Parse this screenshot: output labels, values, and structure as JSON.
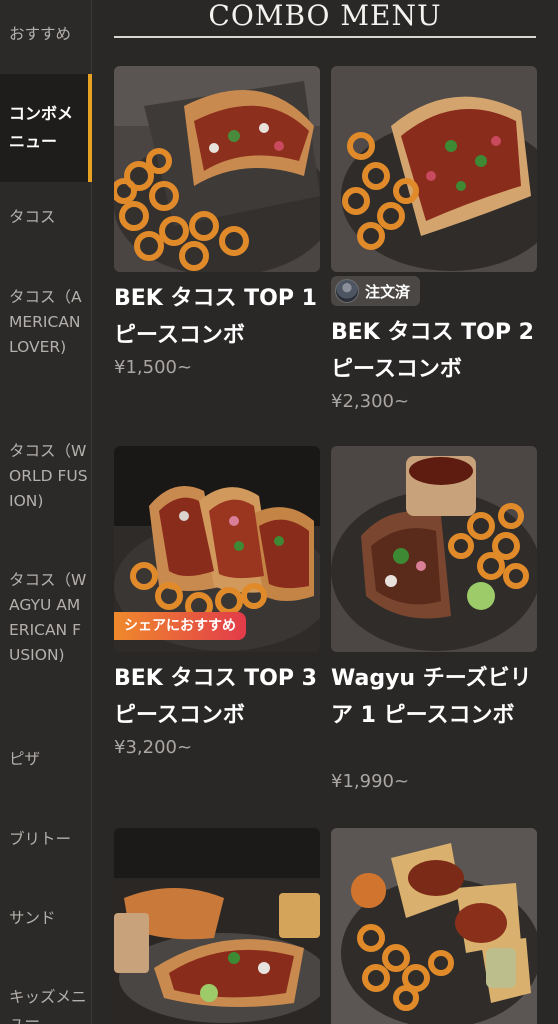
{
  "sidebar": {
    "items": [
      {
        "label": "おすすめ"
      },
      {
        "label": "コンボメニュー"
      },
      {
        "label": "タコス"
      },
      {
        "label": "タコス（AMERICAN LOVER)"
      },
      {
        "label": "タコス（WORLD FUSION)"
      },
      {
        "label": "タコス（WAGYU AMERICAN FUSION)"
      },
      {
        "label": "ピザ"
      },
      {
        "label": "ブリトー"
      },
      {
        "label": "サンド"
      },
      {
        "label": "キッズメニュー"
      }
    ]
  },
  "main": {
    "section_title": "COMBO MENU",
    "cards": [
      {
        "name": "BEK タコス TOP 1 ピースコンボ",
        "price": "¥1,500~"
      },
      {
        "name": "BEK タコス TOP 2ピースコンボ",
        "price": "¥2,300~",
        "badge": "注文済"
      },
      {
        "name": "BEK タコス TOP 3ピースコンボ",
        "price": "¥3,200~",
        "badge": "シェアにおすすめ"
      },
      {
        "name": "Wagyu チーズビリア 1 ピースコンボ",
        "price": "¥1,990~"
      },
      {
        "name": "",
        "price": ""
      },
      {
        "name": "",
        "price": ""
      }
    ]
  },
  "colors": {
    "accent": "#e6a220",
    "background": "#2a2827",
    "badge_gradient": [
      "#ef8a2c",
      "#e23b4a"
    ]
  }
}
